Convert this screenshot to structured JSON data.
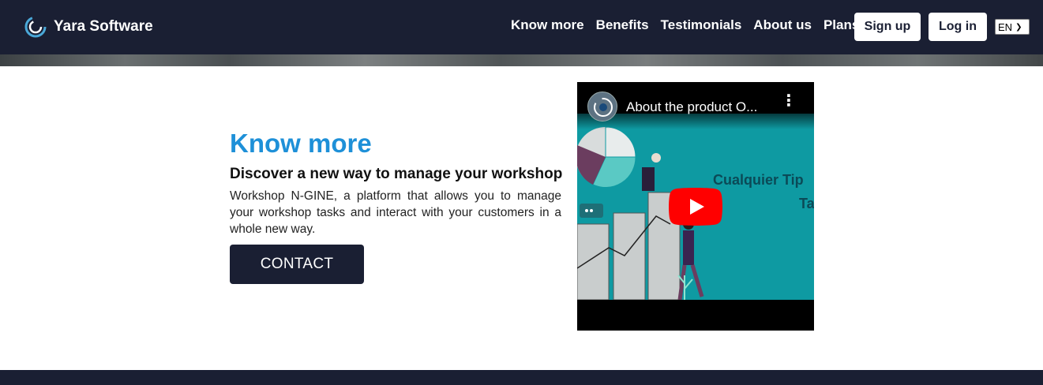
{
  "brand": {
    "name": "Yara Software",
    "logo_icon": "yara-logo-icon"
  },
  "nav": {
    "links": [
      "Know more",
      "Benefits",
      "Testimonials",
      "About us",
      "Plans"
    ],
    "signup_label": "Sign up",
    "login_label": "Log in",
    "language": "EN"
  },
  "section": {
    "title": "Know more",
    "subtitle": "Discover a new way to manage your workshop",
    "body": "Workshop N-GINE, a platform that allows you to manage your workshop tasks and interact with your customers in a whole new way.",
    "contact_label": "CONTACT"
  },
  "video": {
    "title": "About the product O...",
    "overlay_line1": "Cualquier Tip",
    "overlay_line2": "Ta",
    "play_icon": "youtube-play-icon",
    "menu_icon": "more-vertical-icon"
  },
  "colors": {
    "navy": "#1a1f33",
    "accent_blue": "#1e90d8",
    "video_teal": "#0e9aa2",
    "youtube_red": "#ff0000"
  }
}
